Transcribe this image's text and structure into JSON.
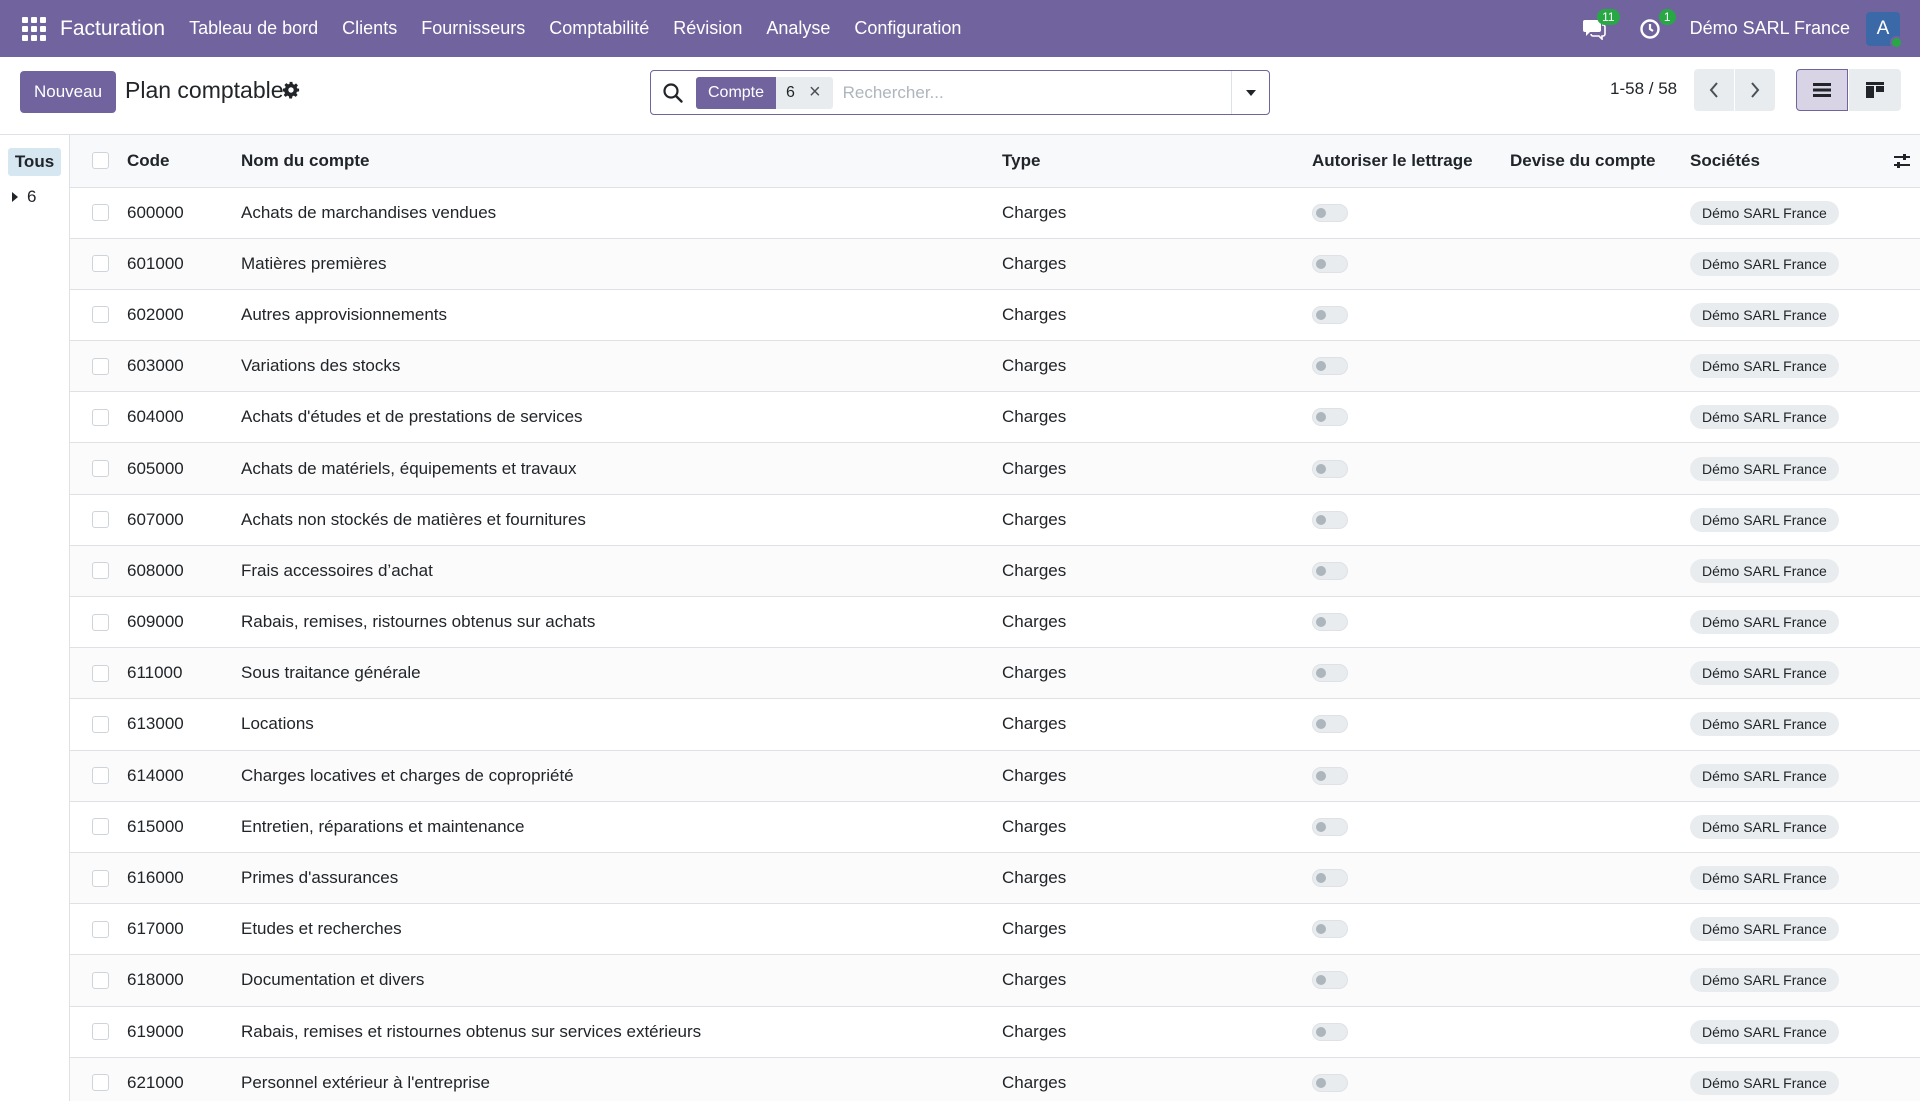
{
  "navbar": {
    "app_name": "Facturation",
    "menu": [
      "Tableau de bord",
      "Clients",
      "Fournisseurs",
      "Comptabilité",
      "Révision",
      "Analyse",
      "Configuration"
    ],
    "messages_count": "11",
    "activities_count": "1",
    "company": "Démo SARL France",
    "avatar_letter": "A"
  },
  "control": {
    "new_label": "Nouveau",
    "title": "Plan comptable",
    "search": {
      "facet_label": "Compte",
      "facet_value": "6",
      "placeholder": "Rechercher..."
    },
    "pager": "1-58 / 58"
  },
  "sidepanel": {
    "all_label": "Tous",
    "group_label": "6"
  },
  "table": {
    "headers": {
      "code": "Code",
      "name": "Nom du compte",
      "type": "Type",
      "reconcile": "Autoriser le lettrage",
      "currency": "Devise du compte",
      "companies": "Sociétés"
    },
    "rows": [
      {
        "code": "600000",
        "name": "Achats de marchandises vendues",
        "type": "Charges",
        "company": "Démo SARL France"
      },
      {
        "code": "601000",
        "name": "Matières premières",
        "type": "Charges",
        "company": "Démo SARL France"
      },
      {
        "code": "602000",
        "name": "Autres approvisionnements",
        "type": "Charges",
        "company": "Démo SARL France"
      },
      {
        "code": "603000",
        "name": "Variations des stocks",
        "type": "Charges",
        "company": "Démo SARL France"
      },
      {
        "code": "604000",
        "name": "Achats d'études et de prestations de services",
        "type": "Charges",
        "company": "Démo SARL France"
      },
      {
        "code": "605000",
        "name": "Achats de matériels, équipements et travaux",
        "type": "Charges",
        "company": "Démo SARL France"
      },
      {
        "code": "607000",
        "name": "Achats non stockés de matières et fournitures",
        "type": "Charges",
        "company": "Démo SARL France"
      },
      {
        "code": "608000",
        "name": "Frais accessoires d’achat",
        "type": "Charges",
        "company": "Démo SARL France"
      },
      {
        "code": "609000",
        "name": "Rabais, remises, ristournes obtenus sur achats",
        "type": "Charges",
        "company": "Démo SARL France"
      },
      {
        "code": "611000",
        "name": "Sous traitance générale",
        "type": "Charges",
        "company": "Démo SARL France"
      },
      {
        "code": "613000",
        "name": "Locations",
        "type": "Charges",
        "company": "Démo SARL France"
      },
      {
        "code": "614000",
        "name": "Charges locatives et charges de copropriété",
        "type": "Charges",
        "company": "Démo SARL France"
      },
      {
        "code": "615000",
        "name": "Entretien, réparations et maintenance",
        "type": "Charges",
        "company": "Démo SARL France"
      },
      {
        "code": "616000",
        "name": "Primes d'assurances",
        "type": "Charges",
        "company": "Démo SARL France"
      },
      {
        "code": "617000",
        "name": "Etudes et recherches",
        "type": "Charges",
        "company": "Démo SARL France"
      },
      {
        "code": "618000",
        "name": "Documentation et divers",
        "type": "Charges",
        "company": "Démo SARL France"
      },
      {
        "code": "619000",
        "name": "Rabais, remises et ristournes obtenus sur services extérieurs",
        "type": "Charges",
        "company": "Démo SARL France"
      },
      {
        "code": "621000",
        "name": "Personnel extérieur à l'entreprise",
        "type": "Charges",
        "company": "Démo SARL France"
      }
    ]
  }
}
